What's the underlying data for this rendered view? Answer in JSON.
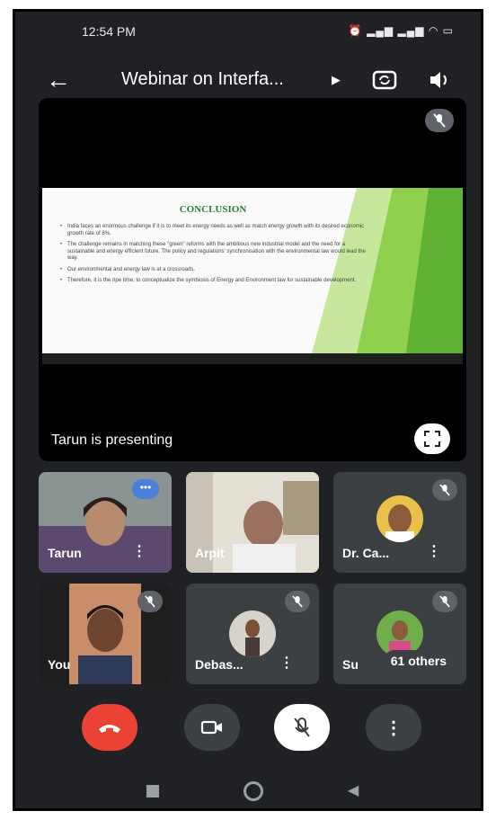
{
  "status": {
    "time": "12:54 PM",
    "icons": [
      "alarm-icon",
      "signal-icon",
      "signal-icon",
      "wifi-icon",
      "battery-icon"
    ]
  },
  "header": {
    "title": "Webinar on Interfa..."
  },
  "stage": {
    "presenter_label": "Tarun is presenting",
    "slide": {
      "title": "CONCLUSION",
      "bullets": [
        "India faces an enormous challenge if it is to meet its energy needs as well as match energy growth with its desired economic growth rate of 8%.",
        "The challenge remains in matching these \"green\" reforms with the ambitious new industrial model and the need for a sustainable and energy efficient future. The policy and regulations' synchronisation with the environmental law would lead the way.",
        "Our environmental and energy law is at a crossroads.",
        "Therefore, it is the ripe time, to conceptualize the symbiosis of Energy and Environment law for sustainable development."
      ]
    }
  },
  "participants": [
    {
      "name": "Tarun"
    },
    {
      "name": "Arpit"
    },
    {
      "name": "Dr. Ca..."
    },
    {
      "name": "You"
    },
    {
      "name": "Debas..."
    },
    {
      "name": "Su",
      "others": "61 others"
    }
  ],
  "colors": {
    "background": "#202124",
    "tile": "#3c4043",
    "end_call": "#ea4335",
    "accent_green": "#7cc142",
    "dots_blue": "#4a7fdc"
  }
}
